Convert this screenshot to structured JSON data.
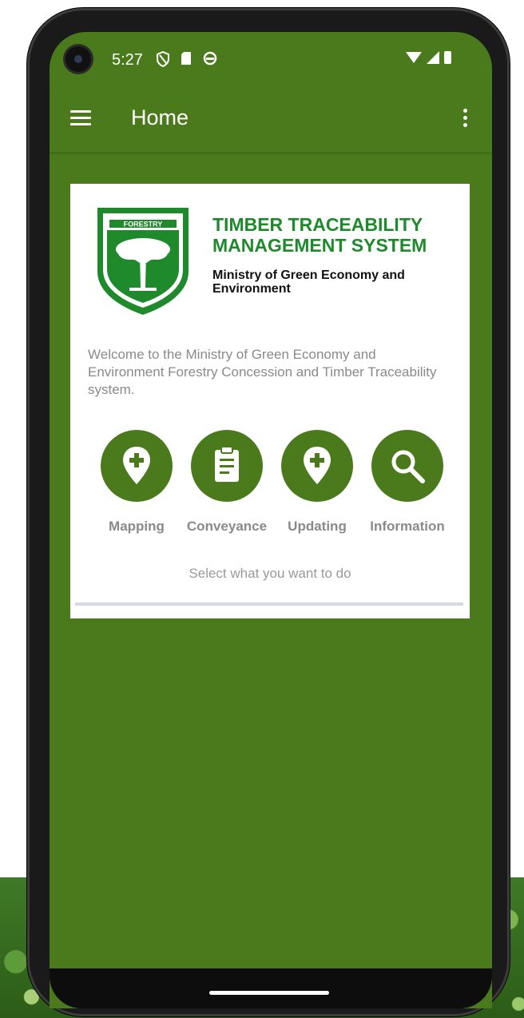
{
  "status_bar": {
    "time": "5:27",
    "left_icons": [
      "shield-icon",
      "sd-card-icon",
      "sync-icon"
    ],
    "right_icons": [
      "wifi-icon",
      "signal-icon",
      "battery-icon"
    ]
  },
  "app_bar": {
    "title": "Home",
    "menu_icon": "hamburger-menu-icon",
    "overflow_icon": "more-vert-icon"
  },
  "card": {
    "logo": {
      "badge_text": "FORESTRY"
    },
    "app_name_line1": "TIMBER TRACEABILITY",
    "app_name_line2": "MANAGEMENT SYSTEM",
    "ministry": "Ministry of Green Economy and Environment",
    "welcome": "Welcome to the Ministry of Green Economy and Environment Forestry Concession and Timber Traceability system.",
    "actions": [
      {
        "label": "Mapping",
        "icon": "map-pin-plus-icon"
      },
      {
        "label": "Conveyance",
        "icon": "clipboard-icon"
      },
      {
        "label": "Updating",
        "icon": "map-pin-plus-icon"
      },
      {
        "label": "Information",
        "icon": "search-icon"
      }
    ],
    "hint": "Select what you want to do"
  },
  "colors": {
    "primary": "#4a7a1c",
    "title_green": "#1f8a2c",
    "card_bg": "#ffffff",
    "muted_text": "#8a8a8a"
  }
}
